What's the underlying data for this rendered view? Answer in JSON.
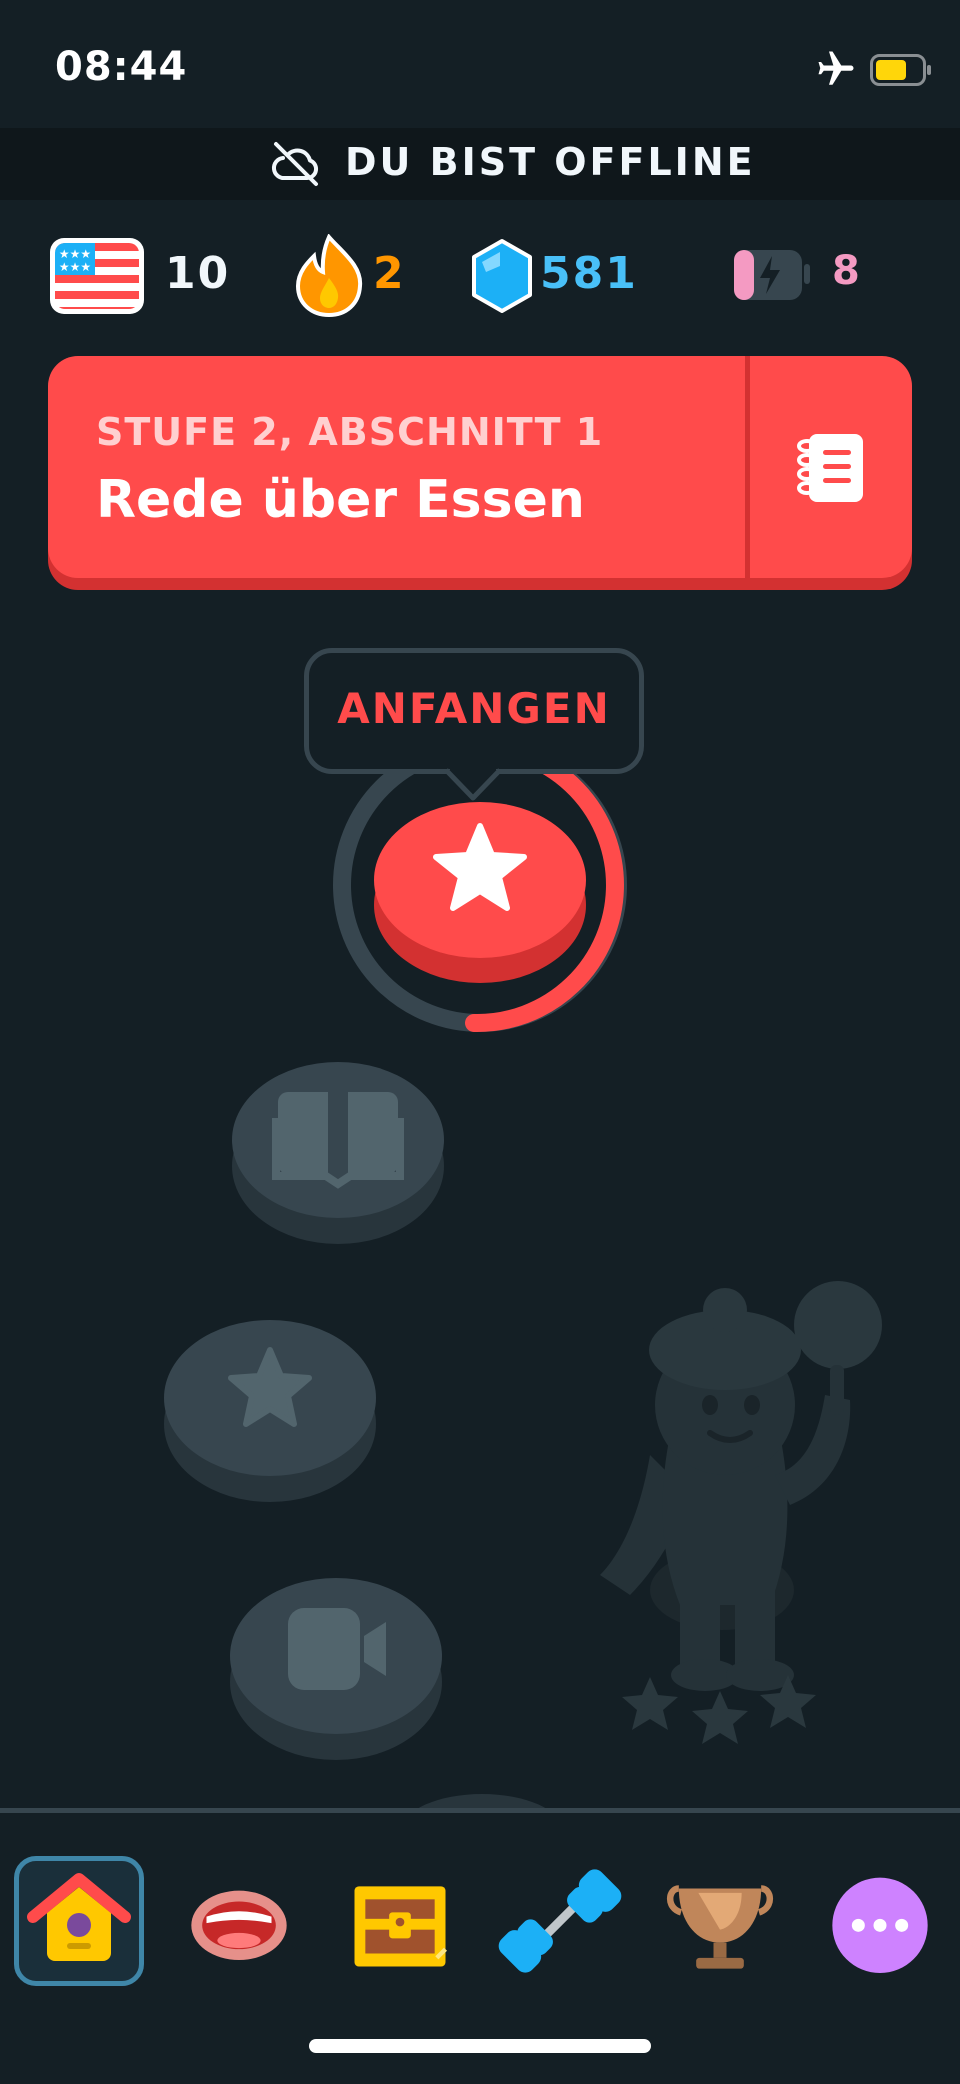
{
  "status_bar": {
    "time": "08:44"
  },
  "offline_banner": {
    "text": "DU BIST OFFLINE"
  },
  "stats": {
    "course_count": "10",
    "streak": "2",
    "gems": "581",
    "energy": "8"
  },
  "unit": {
    "subtitle": "STUFE 2, ABSCHNITT 1",
    "title": "Rede über Essen"
  },
  "start_tooltip": {
    "label": "ANFANGEN"
  },
  "colors": {
    "background": "#141f25",
    "accent_red": "#ff4b4b",
    "streak_orange": "#ff9600",
    "gem_blue": "#49c0f8",
    "energy_pink": "#f49ac2",
    "locked_gray": "#37464f"
  },
  "nav": {
    "items": [
      {
        "icon": "home-icon",
        "selected": true
      },
      {
        "icon": "speak-icon",
        "selected": false
      },
      {
        "icon": "chest-icon",
        "selected": false
      },
      {
        "icon": "practice-icon",
        "selected": false
      },
      {
        "icon": "leagues-icon",
        "selected": false
      },
      {
        "icon": "more-icon",
        "selected": false
      }
    ]
  }
}
